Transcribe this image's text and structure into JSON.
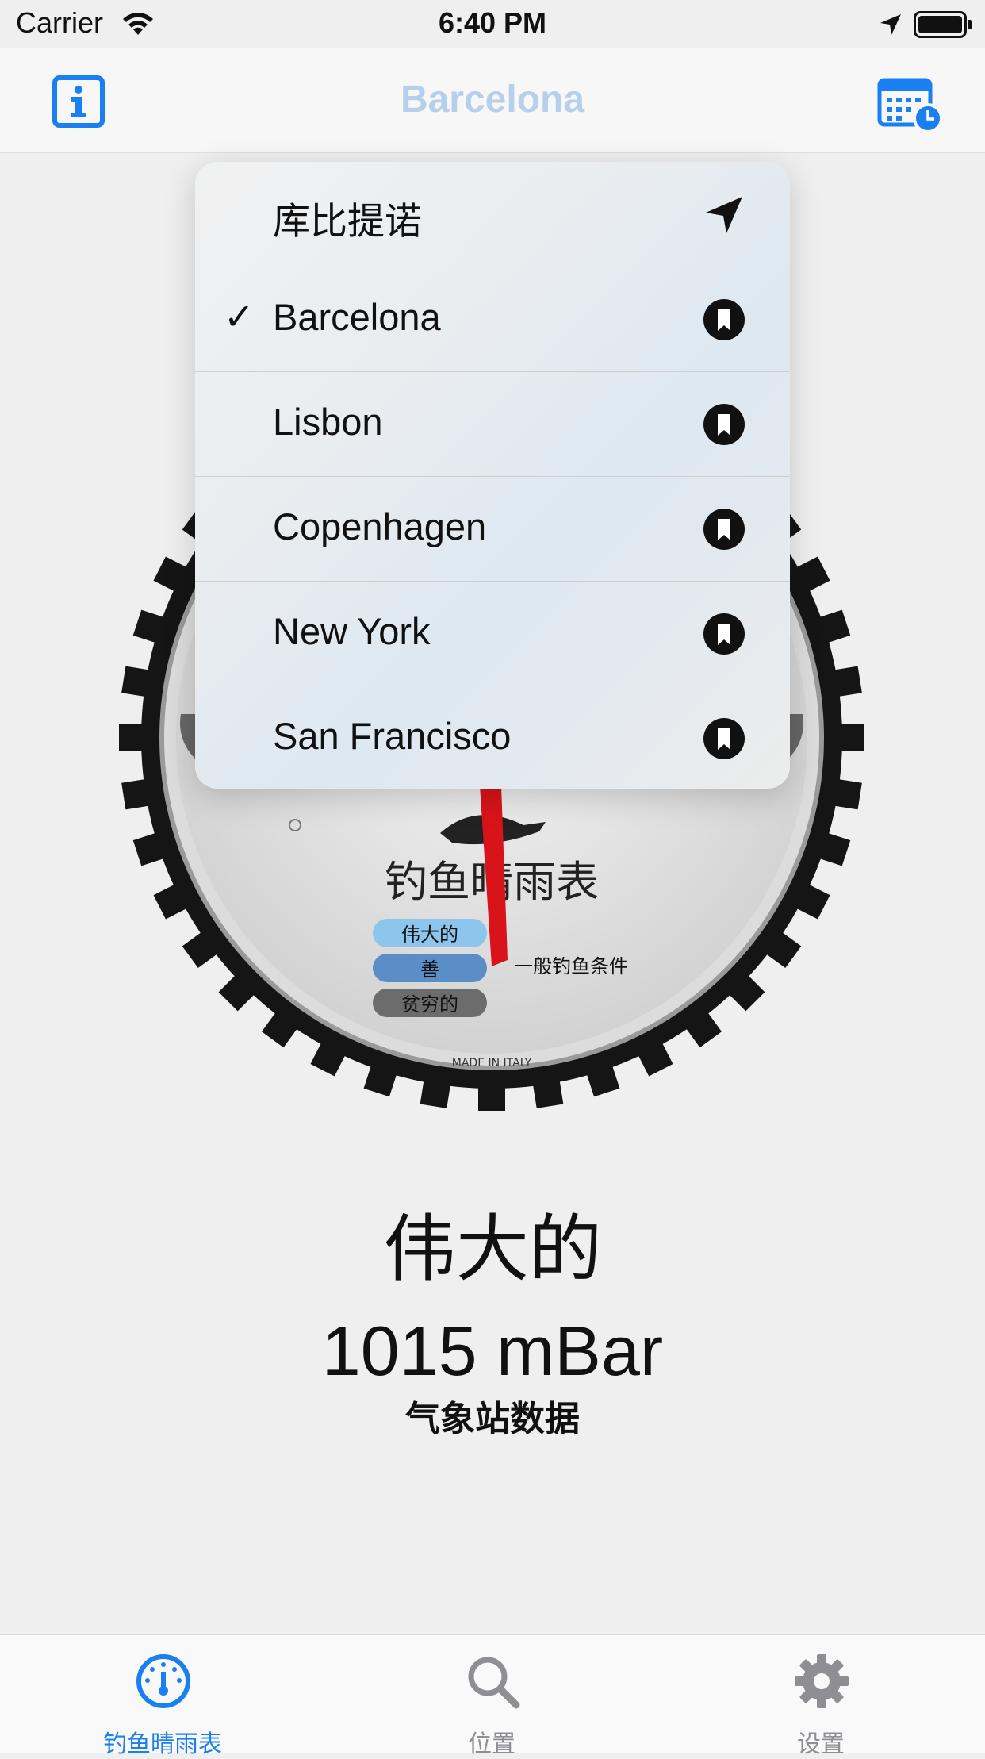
{
  "status_bar": {
    "carrier": "Carrier",
    "time": "6:40 PM"
  },
  "nav": {
    "title": "Barcelona",
    "title_color": "#b6cfea"
  },
  "gauge": {
    "title": "钓鱼晴雨表",
    "legend": [
      "伟大的",
      "善",
      "贫穷的"
    ],
    "pointer_label": "一般钓鱼条件",
    "maker": "MADE IN ITALY"
  },
  "menu": {
    "items": [
      {
        "label": "库比提诺",
        "checked": false,
        "icon": "location-arrow-icon"
      },
      {
        "label": "Barcelona",
        "checked": true,
        "icon": "bookmark-icon"
      },
      {
        "label": "Lisbon",
        "checked": false,
        "icon": "bookmark-icon"
      },
      {
        "label": "Copenhagen",
        "checked": false,
        "icon": "bookmark-icon"
      },
      {
        "label": "New York",
        "checked": false,
        "icon": "bookmark-icon"
      },
      {
        "label": "San Francisco",
        "checked": false,
        "icon": "bookmark-icon"
      }
    ],
    "check_mark": "✓"
  },
  "reading": {
    "quality": "伟大的",
    "pressure": "1015 mBar",
    "source": "气象站数据"
  },
  "tabs": [
    {
      "label": "钓鱼晴雨表",
      "icon": "gauge-icon",
      "active": true
    },
    {
      "label": "位置",
      "icon": "search-icon",
      "active": false
    },
    {
      "label": "设置",
      "icon": "gear-icon",
      "active": false
    }
  ],
  "colors": {
    "accent": "#1a7ff0",
    "inactive": "#8e8e93",
    "needle": "#d8141a"
  }
}
